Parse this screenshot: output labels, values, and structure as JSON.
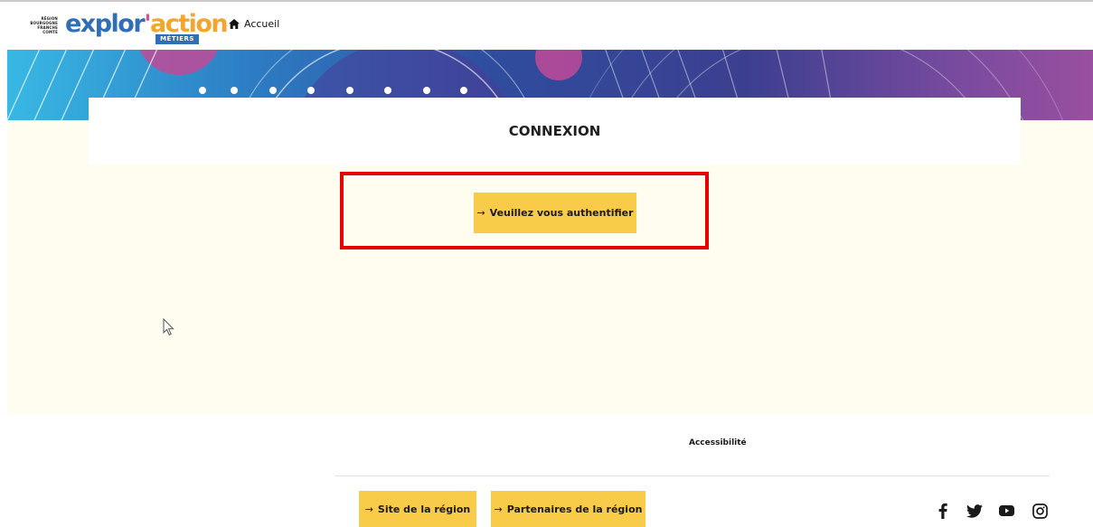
{
  "header": {
    "region_logo_lines": [
      "RÉGION",
      "BOURGOGNE",
      "FRANCHE",
      "COMTÉ"
    ],
    "brand": {
      "part1": "explor",
      "apostrophe": "'",
      "part2": "action",
      "subtitle": "MÉTIERS"
    },
    "home_label": "Accueil"
  },
  "main": {
    "title": "CONNEXION",
    "auth_button": {
      "arrow": "→",
      "label": "Veuillez vous authentifier"
    }
  },
  "footer": {
    "accessibility_label": "Accessibilité",
    "buttons": [
      {
        "arrow": "→",
        "label": "Site de la région"
      },
      {
        "arrow": "→",
        "label": "Partenaires de la région"
      }
    ],
    "social_icons": [
      "facebook-icon",
      "twitter-icon",
      "youtube-icon",
      "instagram-icon"
    ]
  },
  "colors": {
    "accent_yellow": "#f8cb48",
    "content_background": "#fffdf0",
    "highlight_red": "#e60000",
    "brand_blue": "#2e6fb6",
    "brand_orange": "#f2a62d",
    "brand_pink": "#d84f8c"
  }
}
